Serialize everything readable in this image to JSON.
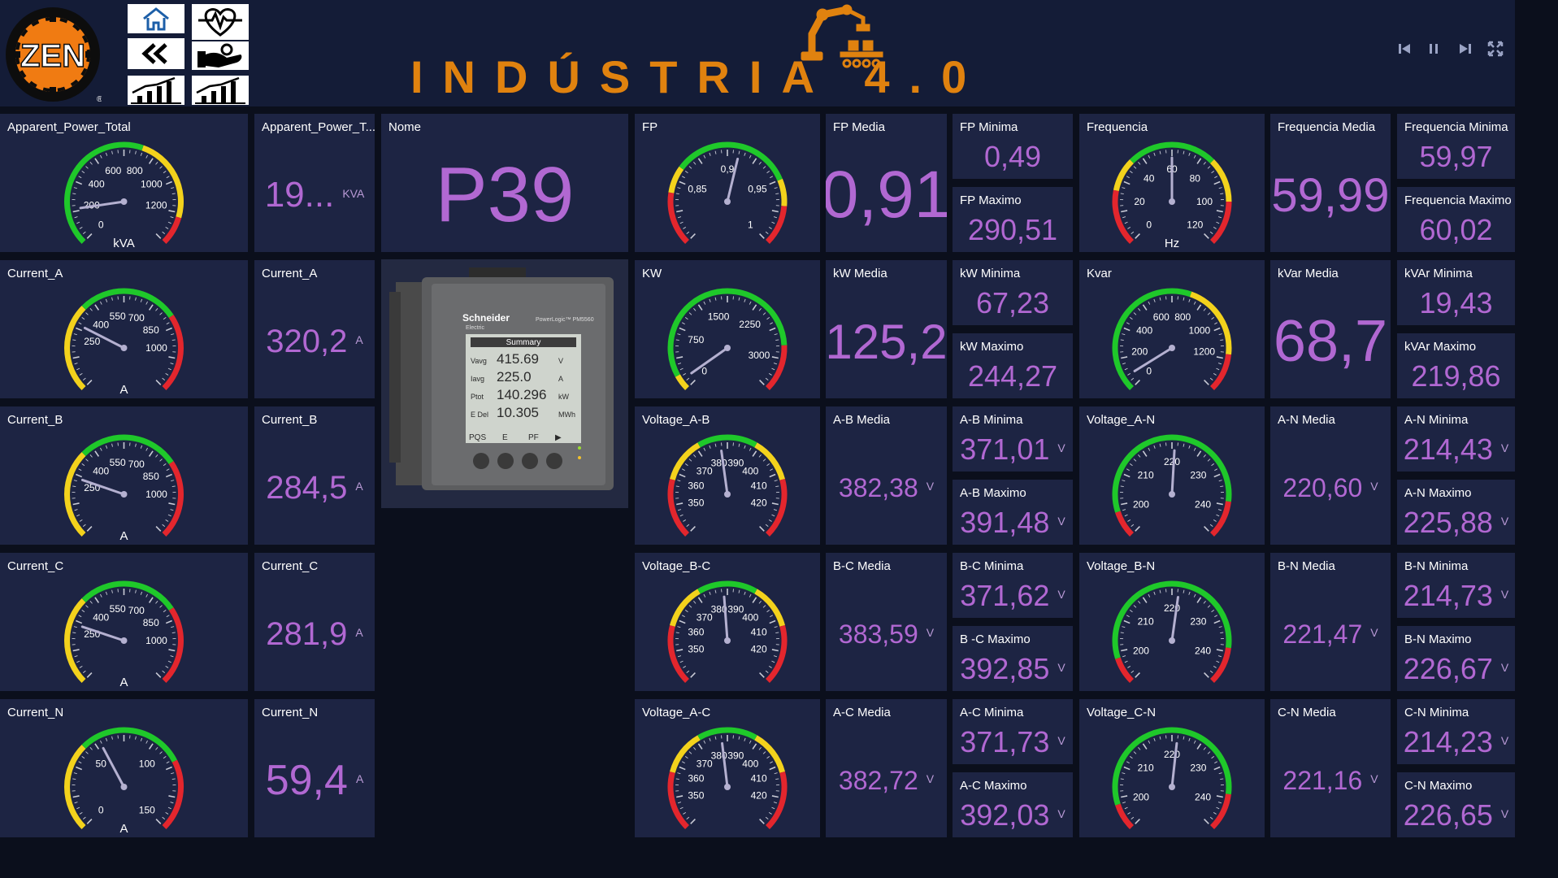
{
  "header": {
    "title": "INDÚSTRIA 4.0",
    "logo_text": "ZEN",
    "nav_buttons": [
      {
        "name": "home",
        "icon": "home-icon"
      },
      {
        "name": "health",
        "icon": "heart-monitor-icon"
      },
      {
        "name": "back",
        "icon": "double-chevron-left-icon"
      },
      {
        "name": "hand-money",
        "icon": "hand-money-icon"
      },
      {
        "name": "chart-growth",
        "icon": "bar-chart-growth-icon"
      },
      {
        "name": "chart-growth-2",
        "icon": "bar-chart-growth-icon"
      }
    ],
    "media_controls": [
      "previous-icon",
      "pause-icon",
      "next-icon",
      "fullscreen-icon"
    ]
  },
  "colors": {
    "tile_bg": "#1d2443",
    "header_bg": "#141c37",
    "page_bg": "#0b0f1c",
    "value_purple": "#b168d2",
    "title_orange": "#e0820f",
    "gauge_red": "#e3262d",
    "gauge_yellow": "#f3d21c",
    "gauge_green": "#1fc82a"
  },
  "gauges": {
    "apparent_power": {
      "title": "Apparent_Power_Total",
      "unit": "kVA",
      "min": 0,
      "max": 1400,
      "value": 190,
      "ticks": [
        "0",
        "200",
        "400",
        "600",
        "800",
        "1000",
        "1200"
      ],
      "ticks_v": [
        0,
        200,
        400,
        600,
        800,
        1000,
        1200
      ],
      "zones": [
        [
          "green",
          0,
          800
        ],
        [
          "yellow",
          800,
          1250
        ],
        [
          "red",
          1250,
          1400
        ]
      ]
    },
    "current_a": {
      "title": "Current_A",
      "unit": "A",
      "min": 0,
      "max": 1200,
      "value": 320.2,
      "ticks": [
        "250",
        "400",
        "550",
        "700",
        "850",
        "1000"
      ],
      "ticks_v": [
        250,
        400,
        550,
        700,
        850,
        1000
      ],
      "zones": [
        [
          "yellow",
          0,
          400
        ],
        [
          "green",
          400,
          850
        ],
        [
          "red",
          850,
          1200
        ]
      ]
    },
    "current_b": {
      "title": "Current_B",
      "unit": "A",
      "min": 0,
      "max": 1200,
      "value": 284.5,
      "ticks": [
        "250",
        "400",
        "550",
        "700",
        "850",
        "1000"
      ],
      "ticks_v": [
        250,
        400,
        550,
        700,
        850,
        1000
      ],
      "zones": [
        [
          "yellow",
          0,
          400
        ],
        [
          "green",
          400,
          850
        ],
        [
          "red",
          850,
          1200
        ]
      ]
    },
    "current_c": {
      "title": "Current_C",
      "unit": "A",
      "min": 0,
      "max": 1200,
      "value": 281.9,
      "ticks": [
        "250",
        "400",
        "550",
        "700",
        "850",
        "1000"
      ],
      "ticks_v": [
        250,
        400,
        550,
        700,
        850,
        1000
      ],
      "zones": [
        [
          "yellow",
          0,
          400
        ],
        [
          "green",
          400,
          850
        ],
        [
          "red",
          850,
          1200
        ]
      ]
    },
    "current_n": {
      "title": "Current_N",
      "unit": "A",
      "min": 0,
      "max": 150,
      "value": 59.4,
      "ticks": [
        "0",
        "50",
        "100",
        "150"
      ],
      "ticks_v": [
        0,
        50,
        100,
        150
      ],
      "zones": [
        [
          "yellow",
          0,
          50
        ],
        [
          "green",
          50,
          110
        ],
        [
          "red",
          110,
          150
        ]
      ]
    },
    "fp": {
      "title": "FP",
      "unit": "",
      "min": 0.8,
      "max": 1.0,
      "value": 0.91,
      "ticks": [
        "0,85",
        "0,9",
        "0,95",
        "1"
      ],
      "ticks_v": [
        0.85,
        0.9,
        0.95,
        1.0
      ],
      "zones": [
        [
          "red",
          0.8,
          0.84
        ],
        [
          "yellow",
          0.84,
          0.86
        ],
        [
          "green",
          0.86,
          0.95
        ],
        [
          "yellow",
          0.95,
          0.97
        ],
        [
          "red",
          0.97,
          1.0
        ]
      ]
    },
    "frequencia": {
      "title": "Frequencia",
      "unit": "Hz",
      "min": 0,
      "max": 120,
      "value": 59.99,
      "ticks": [
        "0",
        "20",
        "40",
        "60",
        "80",
        "100",
        "120"
      ],
      "ticks_v": [
        0,
        20,
        40,
        60,
        80,
        100,
        120
      ],
      "zones": [
        [
          "red",
          0,
          25
        ],
        [
          "yellow",
          25,
          40
        ],
        [
          "green",
          40,
          80
        ],
        [
          "yellow",
          80,
          100
        ],
        [
          "red",
          100,
          120
        ]
      ]
    },
    "kw": {
      "title": "KW",
      "unit": "",
      "min": 0,
      "max": 3400,
      "value": 125.2,
      "ticks": [
        "0",
        "750",
        "1500",
        "2250",
        "3000"
      ],
      "ticks_v": [
        0,
        750,
        1500,
        2250,
        3000
      ],
      "zones": [
        [
          "yellow",
          0,
          200
        ],
        [
          "green",
          200,
          2800
        ],
        [
          "red",
          2800,
          3400
        ]
      ]
    },
    "kvar": {
      "title": "Kvar",
      "unit": "",
      "min": 0,
      "max": 1400,
      "value": 68.7,
      "ticks": [
        "0",
        "200",
        "400",
        "600",
        "800",
        "1000",
        "1200"
      ],
      "ticks_v": [
        0,
        200,
        400,
        600,
        800,
        1000,
        1200
      ],
      "zones": [
        [
          "green",
          0,
          800
        ],
        [
          "yellow",
          800,
          1200
        ],
        [
          "red",
          1200,
          1400
        ]
      ]
    },
    "voltage_ab": {
      "title": "Voltage_A-B",
      "unit": "",
      "min": 340,
      "max": 430,
      "value": 382.38,
      "ticks": [
        "350",
        "360",
        "370",
        "380",
        "390",
        "400",
        "410",
        "420"
      ],
      "ticks_v": [
        350,
        360,
        370,
        380,
        390,
        400,
        410,
        420
      ],
      "zones": [
        [
          "red",
          340,
          360
        ],
        [
          "yellow",
          360,
          375
        ],
        [
          "green",
          375,
          395
        ],
        [
          "yellow",
          395,
          410
        ],
        [
          "red",
          410,
          430
        ]
      ]
    },
    "voltage_bc": {
      "title": "Voltage_B-C",
      "unit": "",
      "min": 340,
      "max": 430,
      "value": 383.59,
      "ticks": [
        "350",
        "360",
        "370",
        "380",
        "390",
        "400",
        "410",
        "420"
      ],
      "ticks_v": [
        350,
        360,
        370,
        380,
        390,
        400,
        410,
        420
      ],
      "zones": [
        [
          "red",
          340,
          360
        ],
        [
          "yellow",
          360,
          375
        ],
        [
          "green",
          375,
          395
        ],
        [
          "yellow",
          395,
          410
        ],
        [
          "red",
          410,
          430
        ]
      ]
    },
    "voltage_ac": {
      "title": "Voltage_A-C",
      "unit": "",
      "min": 340,
      "max": 430,
      "value": 382.72,
      "ticks": [
        "350",
        "360",
        "370",
        "380",
        "390",
        "400",
        "410",
        "420"
      ],
      "ticks_v": [
        350,
        360,
        370,
        380,
        390,
        400,
        410,
        420
      ],
      "zones": [
        [
          "red",
          340,
          360
        ],
        [
          "yellow",
          360,
          375
        ],
        [
          "green",
          375,
          395
        ],
        [
          "yellow",
          395,
          410
        ],
        [
          "red",
          410,
          430
        ]
      ]
    },
    "voltage_an": {
      "title": "Voltage_A-N",
      "unit": "",
      "min": 195,
      "max": 245,
      "value": 220.6,
      "ticks": [
        "200",
        "210",
        "220",
        "230",
        "240"
      ],
      "ticks_v": [
        200,
        210,
        220,
        230,
        240
      ],
      "zones": [
        [
          "red",
          195,
          200
        ],
        [
          "green",
          200,
          238
        ],
        [
          "red",
          238,
          245
        ]
      ]
    },
    "voltage_bn": {
      "title": "Voltage_B-N",
      "unit": "",
      "min": 195,
      "max": 245,
      "value": 221.47,
      "ticks": [
        "200",
        "210",
        "220",
        "230",
        "240"
      ],
      "ticks_v": [
        200,
        210,
        220,
        230,
        240
      ],
      "zones": [
        [
          "red",
          195,
          200
        ],
        [
          "green",
          200,
          238
        ],
        [
          "red",
          238,
          245
        ]
      ]
    },
    "voltage_cn": {
      "title": "Voltage_C-N",
      "unit": "",
      "min": 195,
      "max": 245,
      "value": 221.16,
      "ticks": [
        "200",
        "210",
        "220",
        "230",
        "240"
      ],
      "ticks_v": [
        200,
        210,
        220,
        230,
        240
      ],
      "zones": [
        [
          "red",
          195,
          200
        ],
        [
          "green",
          200,
          238
        ],
        [
          "red",
          238,
          245
        ]
      ]
    }
  },
  "values": {
    "apparent_power_total": {
      "label": "Apparent_Power_T...",
      "value": "19...",
      "unit": "KVA"
    },
    "nome": {
      "label": "Nome",
      "value": "P39"
    },
    "current_a": {
      "label": "Current_A",
      "value": "320,2",
      "unit": "A"
    },
    "current_b": {
      "label": "Current_B",
      "value": "284,5",
      "unit": "A"
    },
    "current_c": {
      "label": "Current_C",
      "value": "281,9",
      "unit": "A"
    },
    "current_n": {
      "label": "Current_N",
      "value": "59,4",
      "unit": "A"
    },
    "fp_media": {
      "label": "FP Media",
      "value": "0,91"
    },
    "fp_minima": {
      "label": "FP Minima",
      "value": "0,49"
    },
    "fp_maximo": {
      "label": "FP Maximo",
      "value": "290,51"
    },
    "freq_media": {
      "label": "Frequencia Media",
      "value": "59,99"
    },
    "freq_minima": {
      "label": "Frequencia Minima",
      "value": "59,97"
    },
    "freq_maximo": {
      "label": "Frequencia Maximo",
      "value": "60,02"
    },
    "kw_media": {
      "label": "kW Media",
      "value": "125,2"
    },
    "kw_minima": {
      "label": "kW Minima",
      "value": "67,23"
    },
    "kw_maximo": {
      "label": "kW Maximo",
      "value": "244,27"
    },
    "kvar_media": {
      "label": "kVar Media",
      "value": "68,7"
    },
    "kvar_minima": {
      "label": "kVAr Minima",
      "value": "19,43"
    },
    "kvar_maximo": {
      "label": "kVAr Maximo",
      "value": "219,86"
    },
    "ab_media": {
      "label": "A-B Media",
      "value": "382,38",
      "unit": "V"
    },
    "ab_minima": {
      "label": "A-B Minima",
      "value": "371,01",
      "unit": "V"
    },
    "ab_maximo": {
      "label": "A-B Maximo",
      "value": "391,48",
      "unit": "V"
    },
    "an_media": {
      "label": "A-N Media",
      "value": "220,60",
      "unit": "V"
    },
    "an_minima": {
      "label": "A-N Minima",
      "value": "214,43",
      "unit": "V"
    },
    "an_maximo": {
      "label": "A-N Maximo",
      "value": "225,88",
      "unit": "V"
    },
    "bc_media": {
      "label": "B-C Media",
      "value": "383,59",
      "unit": "V"
    },
    "bc_minima": {
      "label": "B-C Minima",
      "value": "371,62",
      "unit": "V"
    },
    "bc_maximo": {
      "label": "B -C Maximo",
      "value": "392,85",
      "unit": "V"
    },
    "bn_media": {
      "label": "B-N Media",
      "value": "221,47",
      "unit": "V"
    },
    "bn_minima": {
      "label": "B-N Minima",
      "value": "214,73",
      "unit": "V"
    },
    "bn_maximo": {
      "label": "B-N Maximo",
      "value": "226,67",
      "unit": "V"
    },
    "ac_media": {
      "label": "A-C Media",
      "value": "382,72",
      "unit": "V"
    },
    "ac_minima": {
      "label": "A-C Minima",
      "value": "371,73",
      "unit": "V"
    },
    "ac_maximo": {
      "label": "A-C Maximo",
      "value": "392,03",
      "unit": "V"
    },
    "cn_media": {
      "label": "C-N Media",
      "value": "221,16",
      "unit": "V"
    },
    "cn_minima": {
      "label": "C-N Minima",
      "value": "214,23",
      "unit": "V"
    },
    "cn_maximo": {
      "label": "C-N Maximo",
      "value": "226,65",
      "unit": "V"
    }
  },
  "device": {
    "brand": "Schneider",
    "brand_sub": "Electric",
    "model": "PowerLogic™ PM5560",
    "screen_title": "Summary",
    "rows": [
      {
        "label": "Vavg",
        "value": "415.69",
        "unit": "V"
      },
      {
        "label": "Iavg",
        "value": "225.0",
        "unit": "A"
      },
      {
        "label": "Ptot",
        "value": "140.296",
        "unit": "kW"
      },
      {
        "label": "E Del",
        "value": "10.305",
        "unit": "MWh"
      }
    ],
    "softkeys": [
      "PQS",
      "E",
      "PF",
      "▶"
    ]
  }
}
